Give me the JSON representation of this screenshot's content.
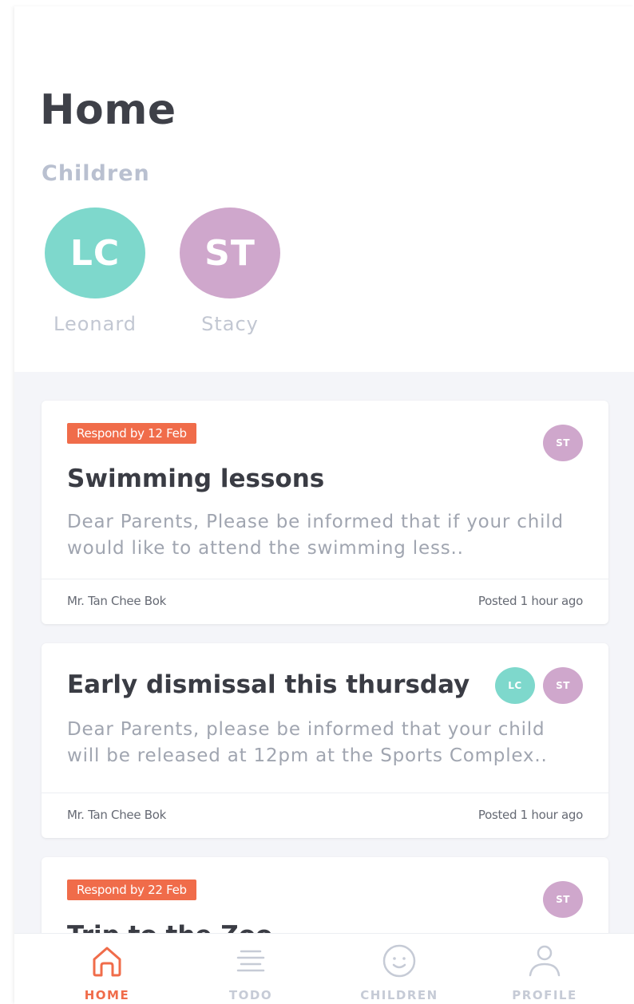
{
  "header": {
    "title": "Home",
    "children_label": "Children"
  },
  "children": [
    {
      "initials": "LC",
      "name": "Leonard",
      "color": "#7ed8cc"
    },
    {
      "initials": "ST",
      "name": "Stacy",
      "color": "#cfa7cc"
    }
  ],
  "posts": [
    {
      "badge": "Respond by 12 Feb",
      "avatars": [
        "ST"
      ],
      "title": "Swimming lessons",
      "body": "Dear Parents, Please be informed that if your child would like to attend the swimming less..",
      "author": "Mr. Tan Chee Bok",
      "posted": "Posted 1 hour ago"
    },
    {
      "badge": "",
      "avatars": [
        "LC",
        "ST"
      ],
      "title": "Early dismissal this thursday",
      "body": "Dear Parents, please be informed that your child will be released at 12pm at the Sports Complex..",
      "author": "Mr. Tan Chee Bok",
      "posted": "Posted 1 hour ago"
    },
    {
      "badge": "Respond by 22 Feb",
      "avatars": [
        "ST"
      ],
      "title": "Trip to the Zoo",
      "body": "",
      "author": "",
      "posted": ""
    }
  ],
  "tabbar": {
    "items": [
      {
        "label": "HOME",
        "icon": "home-icon",
        "active": true
      },
      {
        "label": "TODO",
        "icon": "list-icon",
        "active": false
      },
      {
        "label": "CHILDREN",
        "icon": "smiley-icon",
        "active": false
      },
      {
        "label": "PROFILE",
        "icon": "person-icon",
        "active": false
      }
    ]
  },
  "colors": {
    "accent": "#f06c4a",
    "lc": "#7ed8cc",
    "st": "#cfa7cc",
    "feed_bg": "#f4f5f9"
  }
}
